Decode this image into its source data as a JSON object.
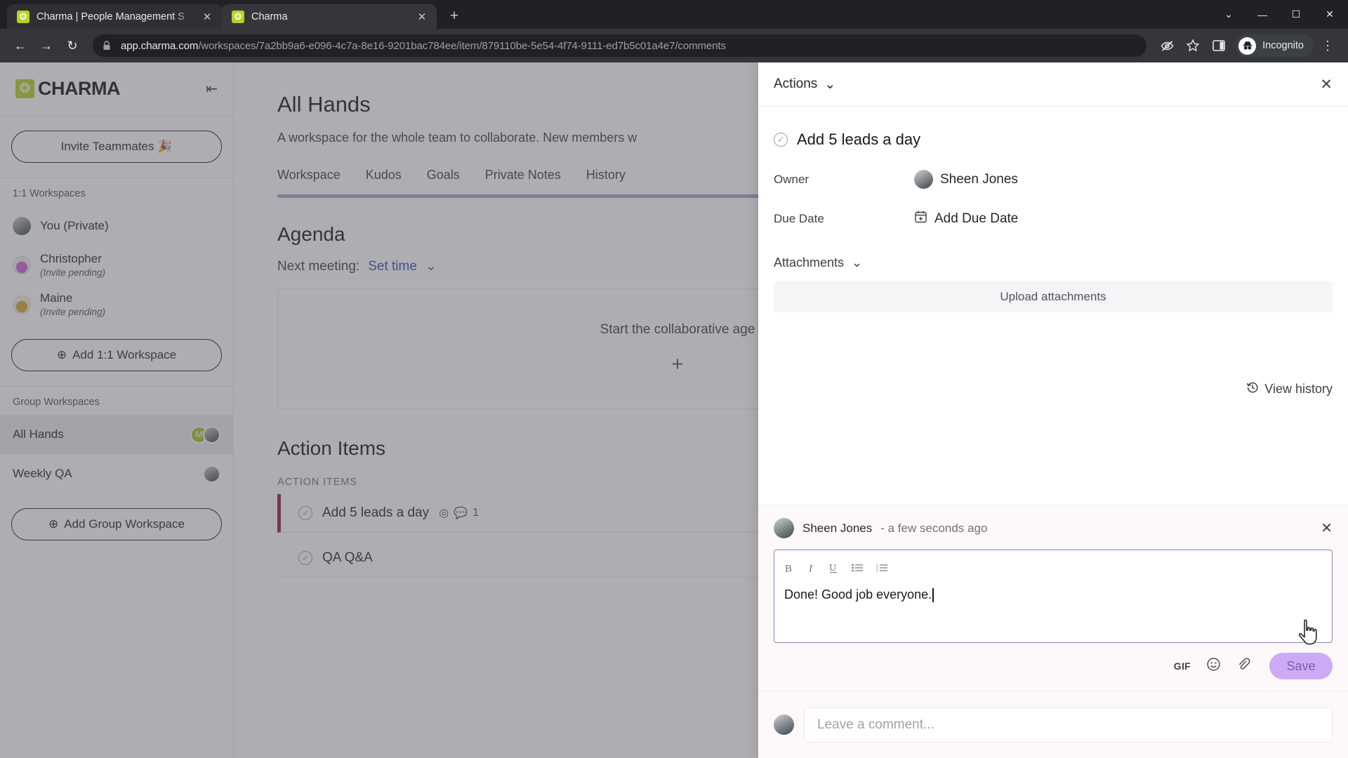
{
  "browser": {
    "tabs": [
      {
        "title": "Charma | People Management S",
        "favicon": "charma-icon",
        "active": false
      },
      {
        "title": "Charma",
        "favicon": "charma-icon",
        "active": true
      }
    ],
    "new_tab_label": "+",
    "window_controls": {
      "minimize": "—",
      "maximize": "☐",
      "close": "✕",
      "chevron": "⌄"
    },
    "nav": {
      "back": "←",
      "forward": "→",
      "reload": "↻"
    },
    "omnibox": {
      "lock_icon": "lock-icon",
      "url_domain": "app.charma.com",
      "url_path": "/workspaces/7a2bb9a6-e096-4c7a-8e16-9201bac784ee/item/879110be-5e54-4f74-9111-ed7b5c01a4e7/comments"
    },
    "toolbar_right": {
      "tracking_protection": "eye-slash-icon",
      "bookmark": "star-icon",
      "side_panel": "side-panel-icon",
      "profile_label": "Incognito",
      "menu": "kebab-menu-icon"
    }
  },
  "sidebar": {
    "brand": "CHARMA",
    "collapse_label": "⇤",
    "invite_button": "Invite Teammates 🎉",
    "one_on_one_header": "1:1 Workspaces",
    "one_on_one": [
      {
        "name": "You (Private)",
        "sub": ""
      },
      {
        "name": "Christopher",
        "sub": "(Invite pending)"
      },
      {
        "name": "Maine",
        "sub": "(Invite pending)"
      }
    ],
    "add_1on1_button": "Add 1:1 Workspace",
    "group_header": "Group Workspaces",
    "groups": [
      {
        "name": "All Hands",
        "badge": "M",
        "selected": true
      },
      {
        "name": "Weekly QA",
        "badge": "",
        "selected": false
      }
    ],
    "add_group_button": "Add Group Workspace",
    "plus_icon": "⊕"
  },
  "main": {
    "title": "All Hands",
    "description": "A workspace for the whole team to collaborate. New members w",
    "tabs": [
      "Workspace",
      "Kudos",
      "Goals",
      "Private Notes",
      "History"
    ],
    "agenda": {
      "heading": "Agenda",
      "next_meeting_label": "Next meeting:",
      "set_time_link": "Set time",
      "chevron": "⌄",
      "empty_hint": "Start the collaborative age",
      "plus": "+"
    },
    "action_items": {
      "heading": "Action Items",
      "section_label": "ACTION ITEMS",
      "rows": [
        {
          "text": "Add 5 leads a day",
          "goal_icon": "target-icon",
          "comment_icon": "comment-icon",
          "comment_count": "1",
          "active": true
        },
        {
          "text": "QA Q&A",
          "goal_icon": "",
          "comment_icon": "",
          "comment_count": "",
          "active": false
        }
      ]
    }
  },
  "drawer": {
    "actions_label": "Actions",
    "actions_chevron": "⌄",
    "close_label": "✕",
    "item_title": "Add 5 leads a day",
    "check_icon": "check-circle-icon",
    "fields": [
      {
        "key": "Owner",
        "value": "Sheen Jones",
        "icon": "avatar"
      },
      {
        "key": "Due Date",
        "value": "Add Due Date",
        "icon": "calendar-plus-icon"
      }
    ],
    "attachments_label": "Attachments",
    "attachments_chevron": "⌄",
    "upload_label": "Upload attachments",
    "view_history_label": "View history",
    "history_icon": "history-icon",
    "composer": {
      "author": "Sheen Jones",
      "timestamp": "- a few seconds ago",
      "close": "✕",
      "toolbar": [
        {
          "name": "bold-icon",
          "glyph": "B"
        },
        {
          "name": "italic-icon",
          "glyph": "I"
        },
        {
          "name": "underline-icon",
          "glyph": "U"
        },
        {
          "name": "bullet-list-icon",
          "glyph": "☰"
        },
        {
          "name": "numbered-list-icon",
          "glyph": "≡"
        }
      ],
      "text": "Done! Good job everyone.",
      "gif_label": "GIF",
      "emoji_icon": "☺",
      "attach_icon": "📎",
      "save_label": "Save"
    },
    "leave_comment_placeholder": "Leave a comment..."
  },
  "colors": {
    "brand_green": "#b3d422",
    "accent_purple": "#cdaaf5",
    "tab_rule": "#b09fcd",
    "active_item_bar": "#8e2040"
  }
}
